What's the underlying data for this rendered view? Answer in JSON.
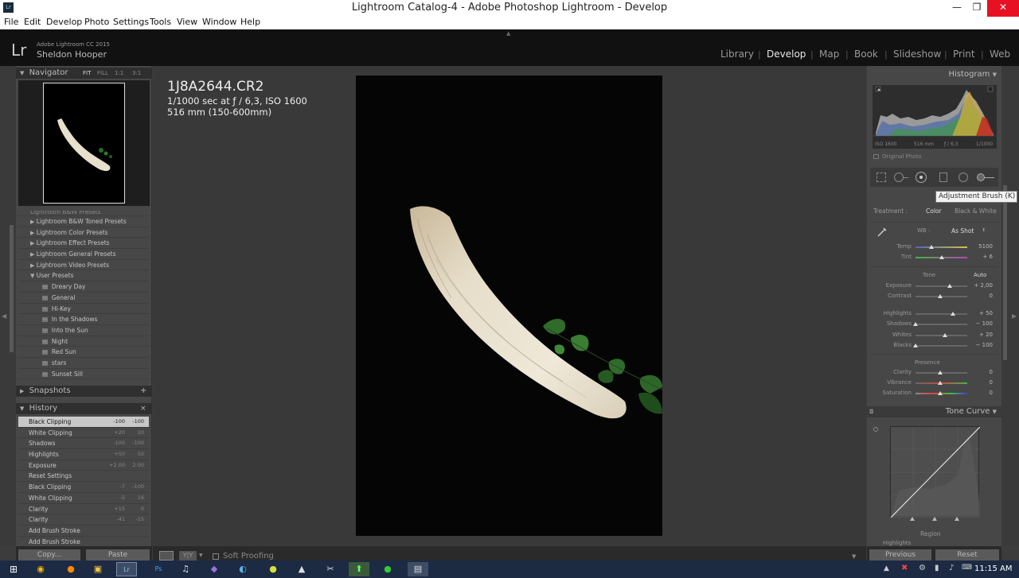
{
  "window": {
    "title": "Lightroom Catalog-4 - Adobe Photoshop Lightroom - Develop",
    "app_icon": "Lr"
  },
  "menu": [
    "File",
    "Edit",
    "Develop",
    "Photo",
    "Settings",
    "Tools",
    "View",
    "Window",
    "Help"
  ],
  "identity": {
    "logo": "Lr",
    "version": "Adobe Lightroom CC 2015",
    "user": "Sheldon Hooper"
  },
  "modules": [
    "Library",
    "Develop",
    "Map",
    "Book",
    "Slideshow",
    "Print",
    "Web"
  ],
  "active_module": "Develop",
  "navigator": {
    "title": "Navigator",
    "zoom": [
      "FIT",
      "FILL",
      "1:1",
      "3:1"
    ]
  },
  "presets": {
    "cut": "Lightroom B&W Presets",
    "folders": [
      "Lightroom B&W Toned Presets",
      "Lightroom Color Presets",
      "Lightroom Effect Presets",
      "Lightroom General Presets",
      "Lightroom Video Presets",
      "User Presets"
    ],
    "user": [
      "Dreary Day",
      "General",
      "Hi-Key",
      "In the Shadows",
      "Into the Sun",
      "Night",
      "Red Sun",
      "stars",
      "Sunset Sill"
    ]
  },
  "snapshots": {
    "title": "Snapshots",
    "add": "+"
  },
  "history": {
    "title": "History",
    "close": "×",
    "rows": [
      {
        "name": "Black Clipping",
        "v1": "-100",
        "v2": "-100"
      },
      {
        "name": "White Clipping",
        "v1": "+20",
        "v2": "20"
      },
      {
        "name": "Shadows",
        "v1": "-100",
        "v2": "-100"
      },
      {
        "name": "Highlights",
        "v1": "+50",
        "v2": "50"
      },
      {
        "name": "Exposure",
        "v1": "+2.00",
        "v2": "2.00"
      },
      {
        "name": "Reset Settings",
        "v1": "",
        "v2": ""
      },
      {
        "name": "Black Clipping",
        "v1": "-7",
        "v2": "-100"
      },
      {
        "name": "White Clipping",
        "v1": "-5",
        "v2": "16"
      },
      {
        "name": "Clarity",
        "v1": "+15",
        "v2": "0"
      },
      {
        "name": "Clarity",
        "v1": "-41",
        "v2": "-15"
      },
      {
        "name": "Add Brush Stroke",
        "v1": "",
        "v2": ""
      },
      {
        "name": "Add Brush Stroke",
        "v1": "",
        "v2": ""
      }
    ]
  },
  "left_buttons": {
    "copy": "Copy...",
    "paste": "Paste"
  },
  "photo_info": {
    "filename": "1J8A2644.CR2",
    "exposure": "1/1000 sec at ƒ / 6,3, ISO 1600",
    "lens": "516 mm (150-600mm)"
  },
  "toolbar": {
    "soft_proofing": "Soft Proofing"
  },
  "histogram": {
    "title": "Histogram",
    "iso": "ISO 1600",
    "focal": "516 mm",
    "aperture": "ƒ / 6,3",
    "shutter": "1/1000",
    "original": "Original Photo"
  },
  "tooltip": "Adjustment Brush (K)",
  "basic": {
    "treatment": "Treatment :",
    "color": "Color",
    "bw": "Black & White",
    "wb_label": "WB :",
    "wb_value": "As Shot",
    "tone": "Tone",
    "auto": "Auto",
    "presence": "Presence",
    "sliders": [
      {
        "label": "Temp",
        "value": "5100",
        "pos": 0.33
      },
      {
        "label": "Tint",
        "value": "+ 6",
        "pos": 0.53
      },
      {
        "label": "Exposure",
        "value": "+ 2,00",
        "pos": 0.7
      },
      {
        "label": "Contrast",
        "value": "0",
        "pos": 0.5
      },
      {
        "label": "Highlights",
        "value": "+ 50",
        "pos": 0.75
      },
      {
        "label": "Shadows",
        "value": "− 100",
        "pos": 0.0
      },
      {
        "label": "Whites",
        "value": "+ 20",
        "pos": 0.6
      },
      {
        "label": "Blacks",
        "value": "− 100",
        "pos": 0.0
      },
      {
        "label": "Clarity",
        "value": "0",
        "pos": 0.5
      },
      {
        "label": "Vibrance",
        "value": "0",
        "pos": 0.5
      },
      {
        "label": "Saturation",
        "value": "0",
        "pos": 0.5
      }
    ]
  },
  "tone_curve": {
    "title": "Tone Curve",
    "region": "Region",
    "highlights": "Highlights"
  },
  "right_buttons": {
    "previous": "Previous",
    "reset": "Reset"
  },
  "taskbar": {
    "time": "11:15 AM"
  }
}
